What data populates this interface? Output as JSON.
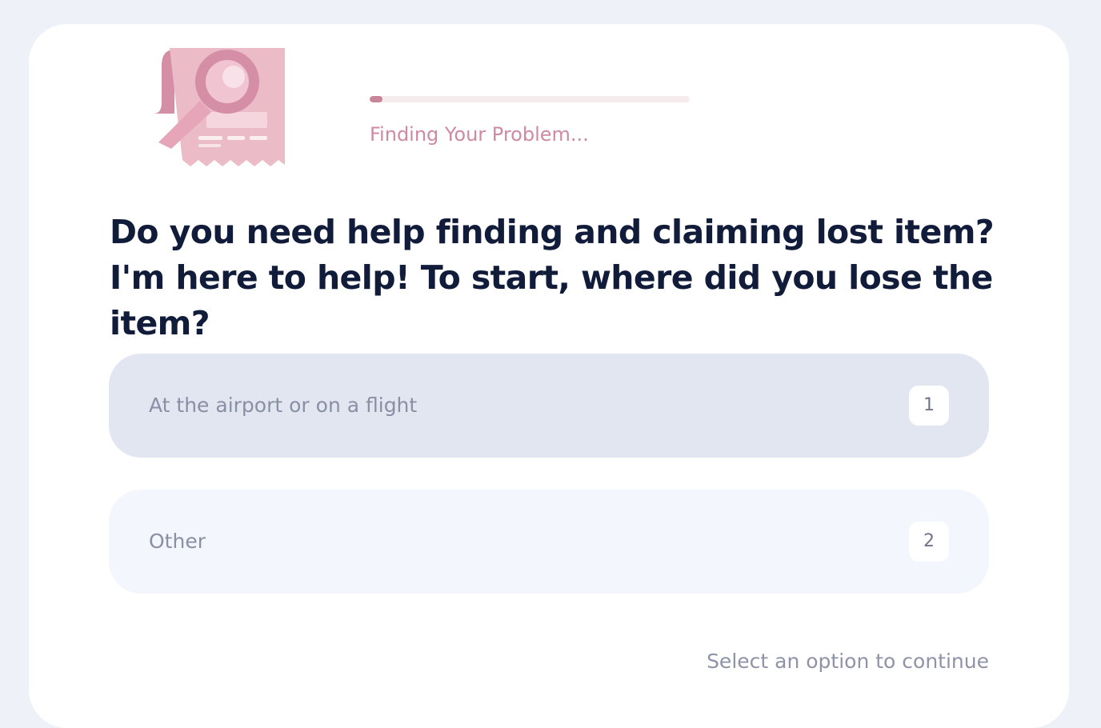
{
  "illustration": {
    "icon": "receipt-magnifier-icon"
  },
  "progress": {
    "value": 0.04,
    "status_text": "Finding Your Problem..."
  },
  "question": {
    "text": "Do you need help finding and claiming lost item? I'm here to help! To start, where did you lose the item?"
  },
  "options": [
    {
      "label": "At the airport or on a flight",
      "key": "1"
    },
    {
      "label": "Other",
      "key": "2"
    }
  ],
  "footer": {
    "hint": "Select an option to continue"
  },
  "colors": {
    "accent": "#cf8aa1",
    "question_text": "#111b3a",
    "option_selected_bg": "#e2e6f1",
    "option_bg": "#f4f6fd"
  }
}
